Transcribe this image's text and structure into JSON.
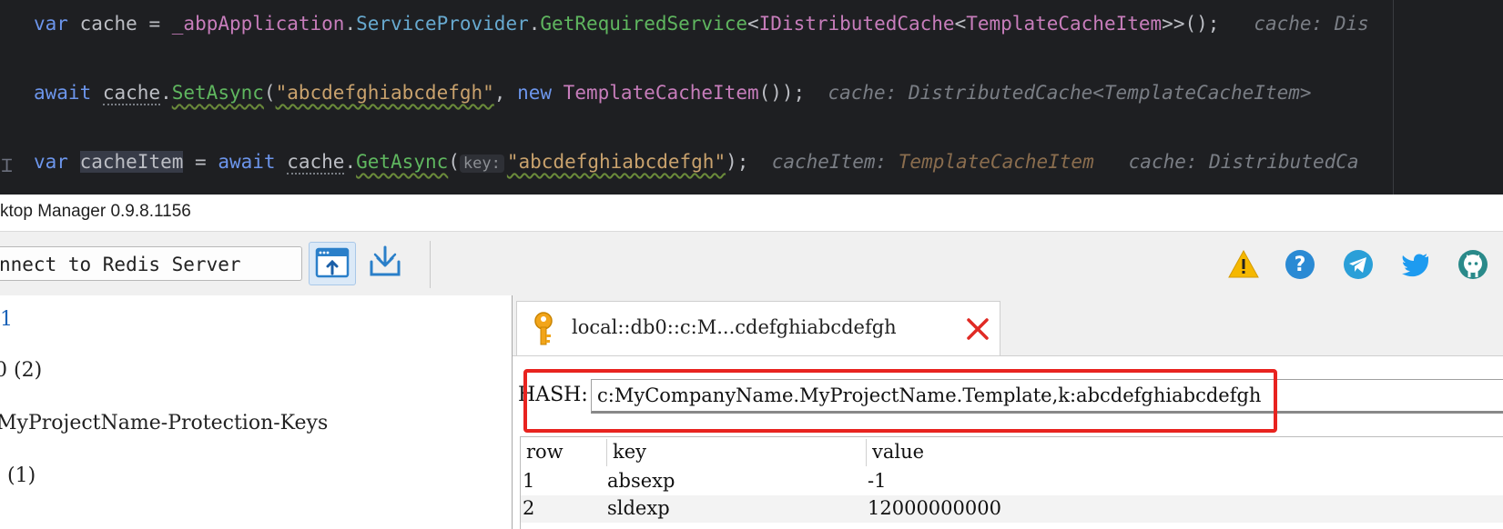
{
  "editor": {
    "line1": {
      "kw": "var",
      "name": "cache",
      "op": "=",
      "app": "_abpApplication",
      "prop": "ServiceProvider",
      "method": "GetRequiredService",
      "type_outer": "IDistributedCache",
      "type_inner": "TemplateCacheItem",
      "tail": ">>();",
      "hint": "cache: Dis"
    },
    "line2": {
      "kw": "await",
      "obj": "cache",
      "method": "SetAsync",
      "arg": "\"abcdefghiabcdefgh\"",
      "new_kw": "new",
      "cls": "TemplateCacheItem",
      "tail": "());",
      "hint": "cache: DistributedCache<TemplateCacheItem>"
    },
    "line3": {
      "kw": "var",
      "name": "cacheItem",
      "op": "=",
      "await_kw": "await",
      "obj": "cache",
      "method": "GetAsync",
      "param_hint": "key:",
      "arg": "\"abcdefghiabcdefgh\"",
      "tail": ");",
      "hint1_label": "cacheItem:",
      "hint1_type": "TemplateCacheItem",
      "hint2": "cache: DistributedCa"
    }
  },
  "window": {
    "title": "ktop Manager 0.9.8.1156"
  },
  "toolbar": {
    "connect_label": "nnect to Redis Server",
    "icons": [
      "open-console-icon",
      "import-icon",
      "warning-icon",
      "help-icon",
      "telegram-icon",
      "twitter-icon",
      "github-icon"
    ]
  },
  "tree": {
    "items": [
      {
        "label": "1"
      },
      {
        "label": "0  (2)"
      },
      {
        "label": "MyProjectName-Protection-Keys"
      },
      {
        "label": ". (1)"
      }
    ]
  },
  "tab": {
    "label": "local::db0::c:M...cdefghiabcdefgh"
  },
  "key_view": {
    "type_label": "HASH:",
    "key_name": "c:MyCompanyName.MyProjectName.Template,k:abcdefghiabcdefgh"
  },
  "table": {
    "headers": [
      "row",
      "key",
      "value"
    ],
    "rows": [
      {
        "row": "1",
        "key": "absexp",
        "value": "-1"
      },
      {
        "row": "2",
        "key": "sldexp",
        "value": "12000000000"
      }
    ]
  },
  "colors": {
    "editor_bg": "#1e1f22",
    "highlight_red": "#e8231f",
    "accent_blue": "#2a8ad4"
  }
}
